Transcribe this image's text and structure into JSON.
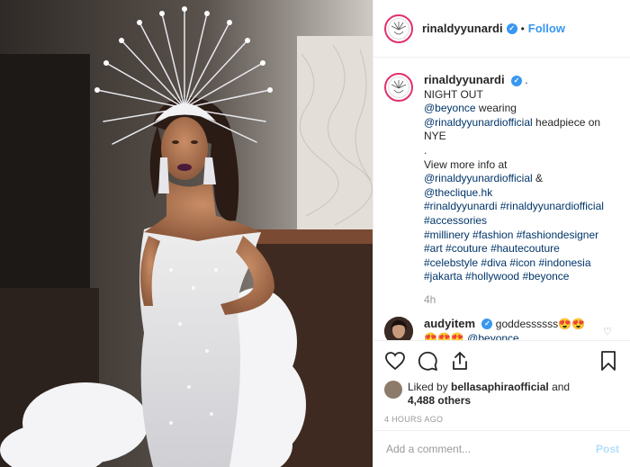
{
  "post": {
    "username": "rinaldyyunardi",
    "follow_label": "Follow",
    "dot": "•",
    "verified_mark": "✓"
  },
  "caption": {
    "username": "rinaldyyunardi",
    "after_name": ".",
    "line1": "NIGHT OUT",
    "mention1": "@beyonce",
    "wearing": " wearing",
    "mention2": "@rinaldyyunardiofficial",
    "headpiece": " headpiece on",
    "nye": "NYE",
    "dot_line": ".",
    "view_more": "View more info at",
    "mention3": "@rinaldyyunardiofficial",
    "amp": " &",
    "mention4": "@theclique.hk",
    "tags_line1": [
      "#rinaldyyunardi",
      "#rinaldyyunardiofficial"
    ],
    "tags_line2": [
      "#accessories"
    ],
    "tags_line3": [
      "#millinery",
      "#fashion",
      "#fashiondesigner"
    ],
    "tags_line4": [
      "#art",
      "#couture",
      "#hautecouture"
    ],
    "tags_line5": [
      "#celebstyle",
      "#diva",
      "#icon",
      "#indonesia"
    ],
    "tags_line6": [
      "#jakarta",
      "#hollywood",
      "#beyonce"
    ],
    "time": "4h"
  },
  "comment": {
    "username": "audyitem",
    "text": "goddessssss😍😍",
    "line2_emoji": "😍😍😍",
    "line2_mention": "@beyonce"
  },
  "icons": {
    "like": "heart-icon",
    "comment": "comment-icon",
    "share": "share-icon",
    "save": "bookmark-icon"
  },
  "likes": {
    "prefix": "Liked by ",
    "user": "bellasaphiraofficial",
    "and": " and",
    "count": "4,488 others"
  },
  "timestamp": "4 HOURS AGO",
  "add_comment": {
    "placeholder": "Add a comment...",
    "post_label": "Post"
  },
  "colors": {
    "accent": "#3897f0",
    "link": "#003569",
    "muted": "#999999",
    "border": "#efefef"
  }
}
